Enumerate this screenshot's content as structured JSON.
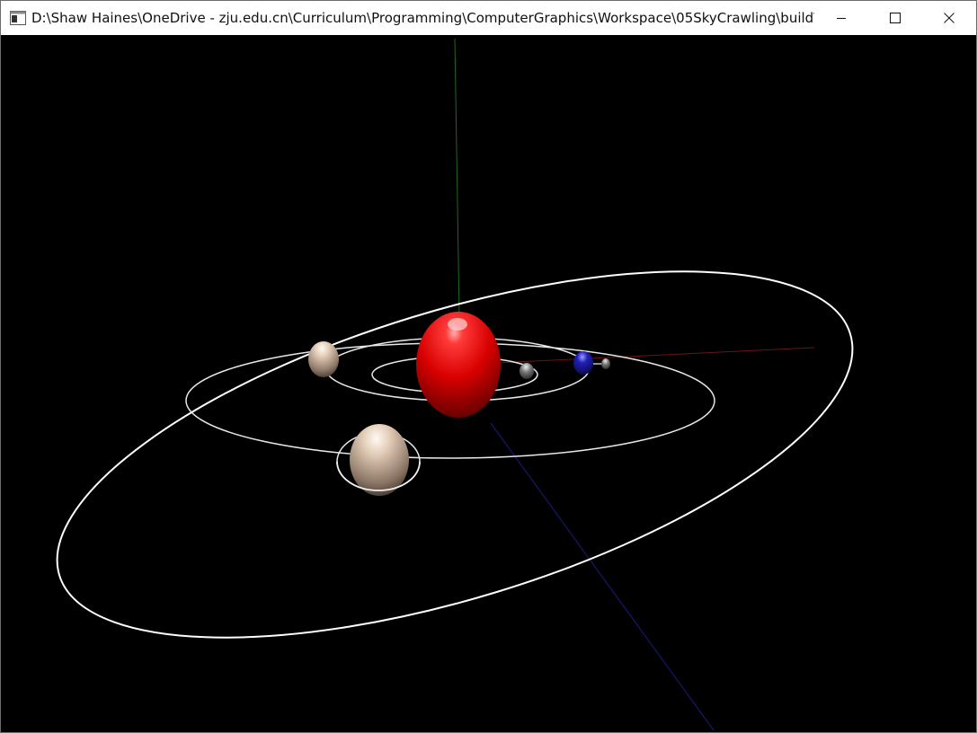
{
  "window": {
    "title": "D:\\Shaw Haines\\OneDrive - zju.edu.cn\\Curriculum\\Programming\\ComputerGraphics\\Workspace\\05SkyCrawling\\build\\...",
    "app_icon": "console-window-icon",
    "controls": [
      {
        "name": "minimize",
        "icon": "minimize-icon"
      },
      {
        "name": "maximize",
        "icon": "maximize-icon"
      },
      {
        "name": "close",
        "icon": "close-icon"
      }
    ]
  },
  "scene": {
    "background": "#000000",
    "sun_color": "#e00000",
    "orbit_color": "#ffffff",
    "planet_color": "#c7ad98",
    "earth_color": "#1a1aa0",
    "moon_color": "#9a9a9a",
    "axis_y_color": "#1e6a1e",
    "axis_x_color": "#6a1414",
    "axis_z_color": "#141a6a"
  }
}
